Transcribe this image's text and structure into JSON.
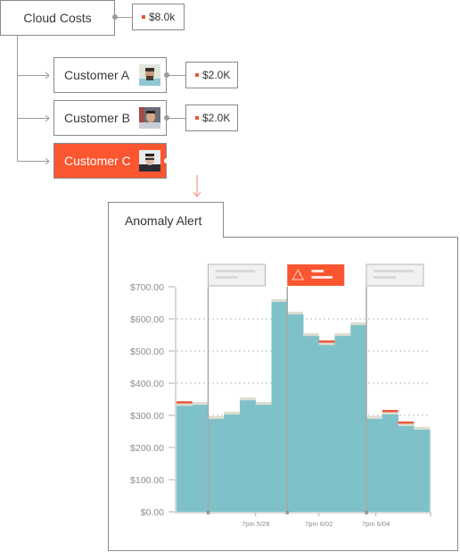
{
  "tree": {
    "root": {
      "label": "Cloud Costs",
      "cost": "$8.0k"
    },
    "customers": [
      {
        "label": "Customer A",
        "cost": "$2.0K",
        "active": false,
        "avatar": "avatar-customer-a"
      },
      {
        "label": "Customer B",
        "cost": "$2.0K",
        "active": false,
        "avatar": "avatar-customer-b"
      },
      {
        "label": "Customer C",
        "cost": null,
        "active": true,
        "avatar": "avatar-customer-c"
      }
    ]
  },
  "colors": {
    "accent": "#fb5630",
    "bar": "#7fc1c8",
    "bar_cap": "#dcdccf",
    "anomaly": "#e8583a",
    "border": "#8a8a8a"
  },
  "alert_panel": {
    "title": "Anomaly Alert",
    "warning_icon": "warning-triangle-icon"
  },
  "chart_data": {
    "type": "bar",
    "title": "Anomaly Alert",
    "xlabel": "",
    "ylabel": "",
    "ylim": [
      0,
      700
    ],
    "y_ticks": [
      "$0.00",
      "$100.00",
      "$200.00",
      "$300.00",
      "$400.00",
      "$500.00",
      "$600.00",
      "$700.00"
    ],
    "x_ticks": [
      "7pm 5/28",
      "7pm 6/02",
      "7pm 6/04"
    ],
    "grid": true,
    "values": [
      330,
      333,
      289,
      303,
      347,
      333,
      653,
      614,
      547,
      519,
      547,
      581,
      289,
      303,
      267,
      256
    ],
    "anomalies": [
      0,
      9,
      13,
      14
    ],
    "annotations": [
      {
        "bar_index": 2,
        "type": "note",
        "highlighted": false
      },
      {
        "bar_index": 7,
        "type": "alert",
        "highlighted": true
      },
      {
        "bar_index": 12,
        "type": "note",
        "highlighted": false
      }
    ]
  }
}
